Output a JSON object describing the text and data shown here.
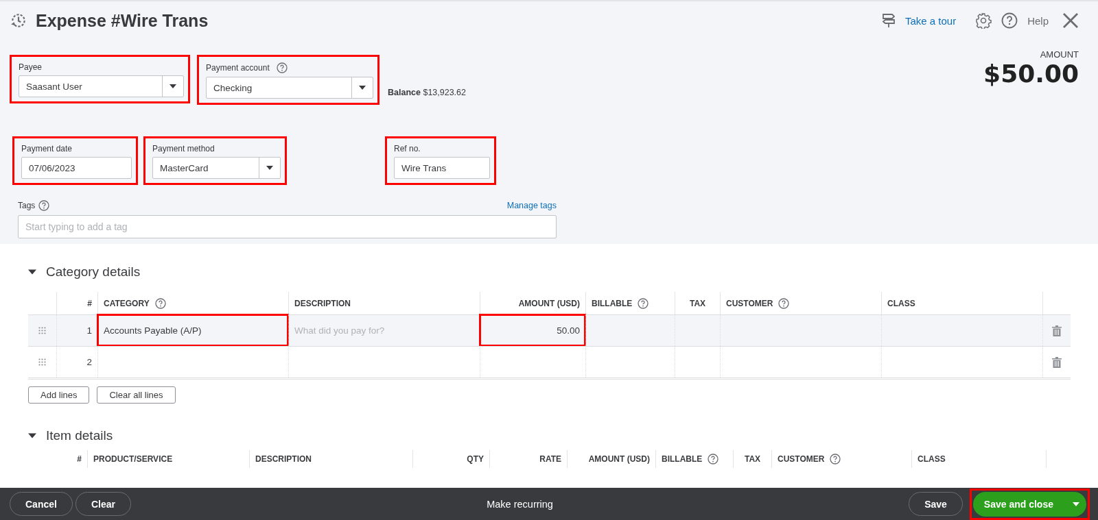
{
  "header": {
    "title": "Expense #Wire Trans",
    "tour_link": "Take a tour",
    "help": "Help"
  },
  "amount": {
    "label": "AMOUNT",
    "value": "$50.00"
  },
  "balance": {
    "label": "Balance",
    "value": "$13,923.62"
  },
  "fields_row1": [
    {
      "label": "Payee",
      "kind": "select",
      "value": "Saasant User",
      "help": false,
      "highlighted": true
    },
    {
      "label": "Payment account",
      "kind": "select",
      "value": "Checking",
      "help": true,
      "highlighted": true
    }
  ],
  "fields_row2": [
    {
      "label": "Payment date",
      "kind": "text",
      "value": "07/06/2023",
      "help": false,
      "highlighted": true
    },
    {
      "label": "Payment method",
      "kind": "select",
      "value": "MasterCard",
      "help": false,
      "highlighted": true
    },
    {
      "label": "Ref no.",
      "kind": "text",
      "value": "Wire Trans",
      "help": false,
      "highlighted": true
    }
  ],
  "tags": {
    "label": "Tags",
    "manage_link": "Manage tags",
    "placeholder": "Start typing to add a tag"
  },
  "category_details": {
    "title": "Category details",
    "expanded": true,
    "columns": [
      {
        "label": "#",
        "help": false
      },
      {
        "label": "CATEGORY",
        "help": true
      },
      {
        "label": "DESCRIPTION",
        "help": false
      },
      {
        "label": "AMOUNT (USD)",
        "help": false
      },
      {
        "label": "BILLABLE",
        "help": true
      },
      {
        "label": "TAX",
        "help": false
      },
      {
        "label": "CUSTOMER",
        "help": true
      },
      {
        "label": "CLASS",
        "help": false
      }
    ],
    "rows": [
      {
        "selected": true,
        "number": "1",
        "category": "Accounts Payable (A/P)",
        "category_highlighted": true,
        "description_placeholder": "What did you pay for?",
        "amount": "50.00",
        "amount_highlighted": true
      },
      {
        "selected": false,
        "number": "2",
        "category_highlighted": false,
        "amount_highlighted": false
      }
    ],
    "buttons": [
      "Add lines",
      "Clear all lines"
    ]
  },
  "item_details": {
    "title": "Item details",
    "expanded": true,
    "columns": [
      {
        "label": "#",
        "help": false
      },
      {
        "label": "PRODUCT/SERVICE",
        "help": false
      },
      {
        "label": "DESCRIPTION",
        "help": false
      },
      {
        "label": "QTY",
        "help": false
      },
      {
        "label": "RATE",
        "help": false
      },
      {
        "label": "AMOUNT (USD)",
        "help": false
      },
      {
        "label": "BILLABLE",
        "help": true
      },
      {
        "label": "TAX",
        "help": false
      },
      {
        "label": "CUSTOMER",
        "help": true
      },
      {
        "label": "CLASS",
        "help": false
      }
    ]
  },
  "footer": {
    "cancel": "Cancel",
    "clear": "Clear",
    "make_recurring": "Make recurring",
    "save": "Save",
    "save_close": "Save and close",
    "save_close_highlighted": true
  }
}
